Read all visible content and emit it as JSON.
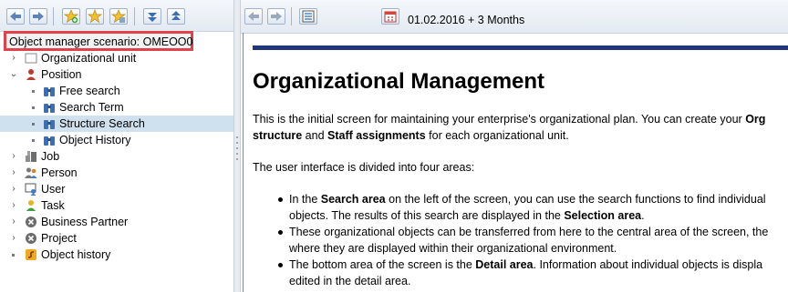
{
  "left_toolbar": {
    "buttons": [
      "back-icon",
      "forward-icon",
      "add-favorite-icon",
      "favorites-icon",
      "favorites-edit-icon",
      "expand-icon",
      "collapse-icon"
    ]
  },
  "scenario": {
    "label": "Object manager scenario: OMEOO0"
  },
  "tree": {
    "nodes": [
      {
        "label": "Organizational unit",
        "icon": "org-unit-icon"
      },
      {
        "label": "Position",
        "icon": "position-icon"
      },
      {
        "label": "Free search",
        "icon": "binoculars-icon"
      },
      {
        "label": "Search Term",
        "icon": "binoculars-icon"
      },
      {
        "label": "Structure Search",
        "icon": "binoculars-icon"
      },
      {
        "label": "Object History",
        "icon": "binoculars-icon"
      },
      {
        "label": "Job",
        "icon": "job-icon"
      },
      {
        "label": "Person",
        "icon": "person-icon"
      },
      {
        "label": "User",
        "icon": "user-icon"
      },
      {
        "label": "Task",
        "icon": "task-icon"
      },
      {
        "label": "Business Partner",
        "icon": "business-partner-icon"
      },
      {
        "label": "Project",
        "icon": "project-icon"
      },
      {
        "label": "Object history",
        "icon": "object-history-icon"
      }
    ]
  },
  "right_toolbar": {
    "date_range": "01.02.2016  + 3 Months"
  },
  "content": {
    "title": "Organizational Management",
    "intro_1": "This is the initial screen for maintaining your enterprise's organizational plan. You can create your ",
    "intro_1_bold": "Org",
    "intro_2_bold_a": "structure",
    "intro_2_mid": " and ",
    "intro_2_bold_b": "Staff assignments",
    "intro_2_end": " for each organizational unit.",
    "areas_text": "The user interface is divided into four areas:",
    "bullet1_a": "In the ",
    "bullet1_bold": "Search area",
    "bullet1_b": " on the left of the screen, you can use the search functions to find individual",
    "bullet1_c": "objects. The results of this search are displayed in the ",
    "bullet1_bold2": "Selection area",
    "bullet1_d": ".",
    "bullet2_a": "These organizational objects can be transferred from here to the central area of the screen, the",
    "bullet2_b": "where they are displayed within their organizational environment.",
    "bullet3_a": "The bottom area of the screen is the ",
    "bullet3_bold": "Detail area",
    "bullet3_b": ". Information about individual objects is displa",
    "bullet3_c": "edited in the detail area."
  }
}
